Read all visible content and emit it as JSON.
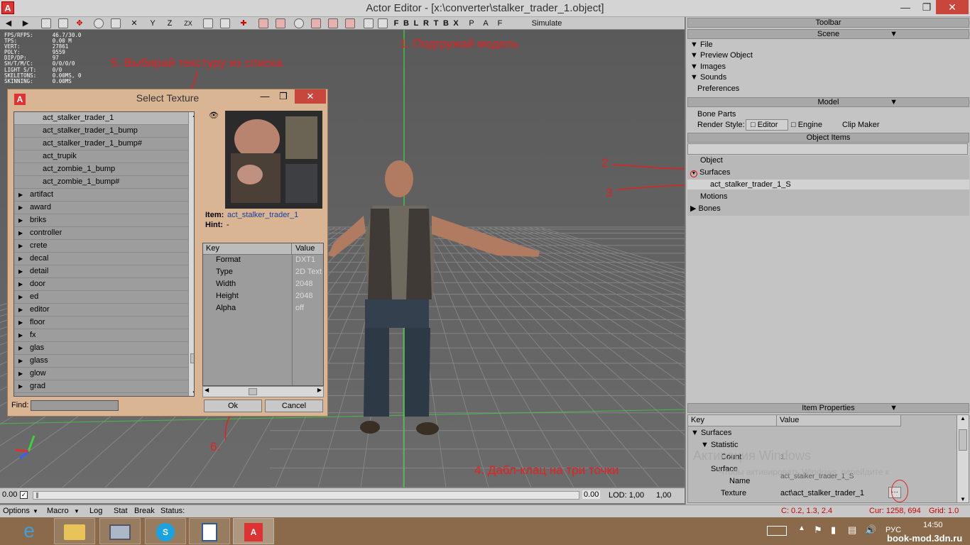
{
  "window": {
    "title": "Actor Editor - [x:\\converter\\stalker_trader_1.object]",
    "icon_letter": "A"
  },
  "toolbar": {
    "letters": [
      "F",
      "B",
      "L",
      "R",
      "T",
      "B",
      "X",
      "P",
      "A",
      "F"
    ],
    "simulate": "Simulate",
    "zx": "ZX"
  },
  "stats": {
    "text": "FPS/RFPS:      46.7/30.0\nTPS:           0.00 M\nVERT:          27861\nPOLY:          9559\nDIP/DP:        97\nSH/T/M/C:      0/0/0/0\nLIGHT S/T:     0/0\nSKELETONS:     0.00MS, 0\nSKINNING:      0.00MS"
  },
  "annotations": {
    "a1": "1. Подгружай модель",
    "a2": "2",
    "a3": "3",
    "a4": "4. Дабл-клац на три точки",
    "a5": "5. Выбирай текстуру из списка",
    "a6": "6."
  },
  "dialog": {
    "title": "Select Texture",
    "files": [
      "act_stalker_trader_1",
      "act_stalker_trader_1_bump",
      "act_stalker_trader_1_bump#",
      "act_trupik",
      "act_zombie_1_bump",
      "act_zombie_1_bump#"
    ],
    "folders": [
      "artifact",
      "award",
      "briks",
      "controller",
      "crete",
      "decal",
      "detail",
      "door",
      "ed",
      "editor",
      "floor",
      "fx",
      "glas",
      "glass",
      "glow",
      "grad"
    ],
    "item_label": "Item:",
    "item_value": "act_stalker_trader_1",
    "hint_label": "Hint:",
    "hint_value": "-",
    "prop_headers": {
      "key": "Key",
      "value": "Value"
    },
    "props": [
      {
        "key": "Format",
        "value": "DXT1"
      },
      {
        "key": "Type",
        "value": "2D Text"
      },
      {
        "key": "Width",
        "value": "2048"
      },
      {
        "key": "Height",
        "value": "2048"
      },
      {
        "key": "Alpha",
        "value": "off"
      }
    ],
    "find_label": "Find:",
    "ok": "Ok",
    "cancel": "Cancel"
  },
  "right_panel": {
    "toolbar": "Toolbar",
    "scene": "Scene",
    "scene_items": [
      "File",
      "Preview Object",
      "Images",
      "Sounds"
    ],
    "preferences": "Preferences",
    "model": "Model",
    "bone_parts": "Bone Parts",
    "render_style": "Render Style:",
    "editor": "Editor",
    "engine": "Engine",
    "clip_maker": "Clip Maker",
    "object_items": "Object Items",
    "object": "Object",
    "surfaces": "Surfaces",
    "surface_name": "act_stalker_trader_1_S",
    "motions": "Motions",
    "bones": "Bones",
    "item_properties": "Item Properties",
    "ip_key": "Key",
    "ip_value": "Value",
    "ip_surfaces": "Surfaces",
    "ip_statistic": "Statistic",
    "ip_count": "Count",
    "ip_count_val": "1",
    "ip_surface": "Surface",
    "ip_name": "Name",
    "ip_name_val": "act_stalker_trader_1_S",
    "ip_texture": "Texture",
    "ip_texture_val": "act\\act_stalker_trader_1",
    "dots": "···",
    "watermark1": "Активация Windows",
    "watermark2": "Чтобы активировать Windows, перейдите к"
  },
  "statusrow": {
    "left_val": "0.00",
    "right_val": "0.00",
    "lod": "LOD: 1,00",
    "lod2": "1,00"
  },
  "bottom": {
    "options": "Options",
    "macro": "Macro",
    "log": "Log",
    "stat": "Stat",
    "break": "Break",
    "status": "Status:",
    "coords": "C: 0.2, 1.3, 2.4",
    "cur": "Cur: 1258, 694",
    "grid": "Grid: 1.0"
  },
  "taskbar": {
    "lang": "РУС",
    "time": "14:50",
    "site": "book-mod.3dn.ru"
  },
  "colors": {
    "annotation": "#e52020",
    "close": "#c9463d",
    "dialog": "#d9b593"
  }
}
